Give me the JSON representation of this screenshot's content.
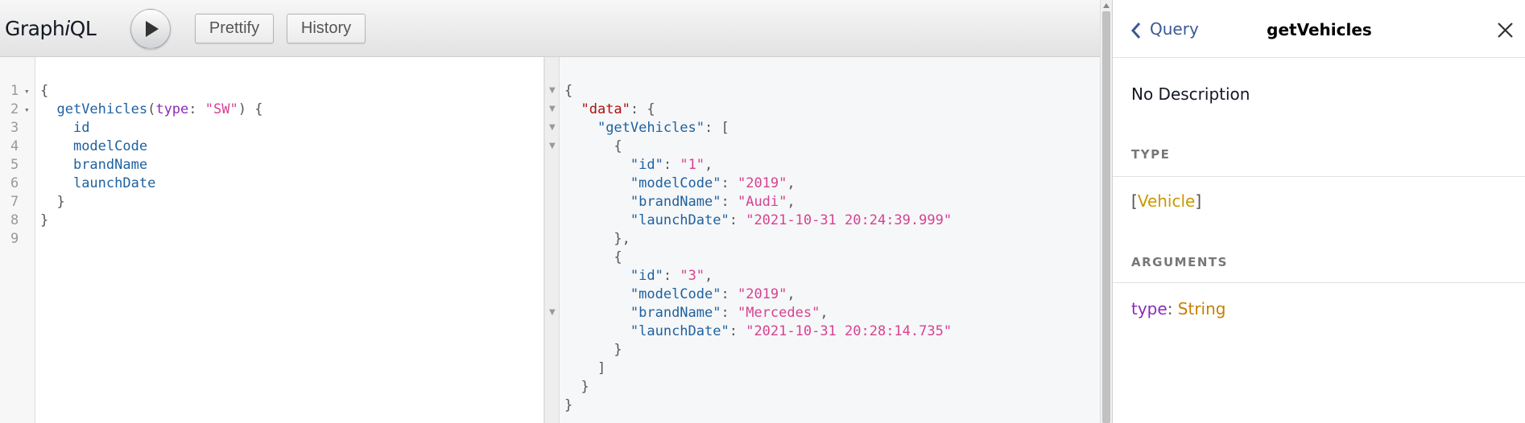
{
  "toolbar": {
    "title_pre": "Graph",
    "title_i": "i",
    "title_post": "QL",
    "run_label": "Execute query",
    "prettify_label": "Prettify",
    "history_label": "History"
  },
  "editor": {
    "line_numbers": [
      "1",
      "2",
      "3",
      "4",
      "5",
      "6",
      "7",
      "8",
      "9"
    ],
    "lines": [
      [
        {
          "t": "{",
          "c": "p"
        }
      ],
      [
        {
          "t": "  ",
          "c": "p"
        },
        {
          "t": "getVehicles",
          "c": "def"
        },
        {
          "t": "(",
          "c": "p"
        },
        {
          "t": "type",
          "c": "kw"
        },
        {
          "t": ": ",
          "c": "p"
        },
        {
          "t": "\"SW\"",
          "c": "s"
        },
        {
          "t": ") {",
          "c": "p"
        }
      ],
      [
        {
          "t": "    ",
          "c": "p"
        },
        {
          "t": "id",
          "c": "def"
        }
      ],
      [
        {
          "t": "    ",
          "c": "p"
        },
        {
          "t": "modelCode",
          "c": "def"
        }
      ],
      [
        {
          "t": "    ",
          "c": "p"
        },
        {
          "t": "brandName",
          "c": "def"
        }
      ],
      [
        {
          "t": "    ",
          "c": "p"
        },
        {
          "t": "launchDate",
          "c": "def"
        }
      ],
      [
        {
          "t": "  }",
          "c": "p"
        }
      ],
      [
        {
          "t": "}",
          "c": "p"
        }
      ],
      [
        {
          "t": "",
          "c": "p"
        }
      ]
    ]
  },
  "result": {
    "lines": [
      [
        {
          "t": "{",
          "c": "p"
        }
      ],
      [
        {
          "t": "  ",
          "c": "p"
        },
        {
          "t": "\"data\"",
          "c": "rk"
        },
        {
          "t": ": {",
          "c": "p"
        }
      ],
      [
        {
          "t": "    ",
          "c": "p"
        },
        {
          "t": "\"getVehicles\"",
          "c": "rk2"
        },
        {
          "t": ": [",
          "c": "p"
        }
      ],
      [
        {
          "t": "      {",
          "c": "p"
        }
      ],
      [
        {
          "t": "        ",
          "c": "p"
        },
        {
          "t": "\"id\"",
          "c": "rk2"
        },
        {
          "t": ": ",
          "c": "p"
        },
        {
          "t": "\"1\"",
          "c": "rv"
        },
        {
          "t": ",",
          "c": "p"
        }
      ],
      [
        {
          "t": "        ",
          "c": "p"
        },
        {
          "t": "\"modelCode\"",
          "c": "rk2"
        },
        {
          "t": ": ",
          "c": "p"
        },
        {
          "t": "\"2019\"",
          "c": "rv"
        },
        {
          "t": ",",
          "c": "p"
        }
      ],
      [
        {
          "t": "        ",
          "c": "p"
        },
        {
          "t": "\"brandName\"",
          "c": "rk2"
        },
        {
          "t": ": ",
          "c": "p"
        },
        {
          "t": "\"Audi\"",
          "c": "rv"
        },
        {
          "t": ",",
          "c": "p"
        }
      ],
      [
        {
          "t": "        ",
          "c": "p"
        },
        {
          "t": "\"launchDate\"",
          "c": "rk2"
        },
        {
          "t": ": ",
          "c": "p"
        },
        {
          "t": "\"2021-10-31 20:24:39.999\"",
          "c": "rv"
        }
      ],
      [
        {
          "t": "      },",
          "c": "p"
        }
      ],
      [
        {
          "t": "      {",
          "c": "p"
        }
      ],
      [
        {
          "t": "        ",
          "c": "p"
        },
        {
          "t": "\"id\"",
          "c": "rk2"
        },
        {
          "t": ": ",
          "c": "p"
        },
        {
          "t": "\"3\"",
          "c": "rv"
        },
        {
          "t": ",",
          "c": "p"
        }
      ],
      [
        {
          "t": "        ",
          "c": "p"
        },
        {
          "t": "\"modelCode\"",
          "c": "rk2"
        },
        {
          "t": ": ",
          "c": "p"
        },
        {
          "t": "\"2019\"",
          "c": "rv"
        },
        {
          "t": ",",
          "c": "p"
        }
      ],
      [
        {
          "t": "        ",
          "c": "p"
        },
        {
          "t": "\"brandName\"",
          "c": "rk2"
        },
        {
          "t": ": ",
          "c": "p"
        },
        {
          "t": "\"Mercedes\"",
          "c": "rv"
        },
        {
          "t": ",",
          "c": "p"
        }
      ],
      [
        {
          "t": "        ",
          "c": "p"
        },
        {
          "t": "\"launchDate\"",
          "c": "rk2"
        },
        {
          "t": ": ",
          "c": "p"
        },
        {
          "t": "\"2021-10-31 20:28:14.735\"",
          "c": "rv"
        }
      ],
      [
        {
          "t": "      }",
          "c": "p"
        }
      ],
      [
        {
          "t": "    ]",
          "c": "p"
        }
      ],
      [
        {
          "t": "  }",
          "c": "p"
        }
      ],
      [
        {
          "t": "}",
          "c": "p"
        }
      ]
    ]
  },
  "docs": {
    "back_label": "Query",
    "title": "getVehicles",
    "description": "No Description",
    "type_section": "TYPE",
    "type_open": "[",
    "type_name": "Vehicle",
    "type_close": "]",
    "args_section": "ARGUMENTS",
    "arg_name": "type",
    "arg_sep": ": ",
    "arg_type": "String"
  },
  "colors": {
    "keyword_field": "#1F61A0",
    "argument": "#8B2BB9",
    "string": "#D64292",
    "result_key": "#A11",
    "type_link": "#CA9800",
    "back_link": "#3B5998"
  },
  "icons": [
    "play-icon",
    "chevron-left-icon",
    "close-icon",
    "fold-arrow-icon"
  ]
}
